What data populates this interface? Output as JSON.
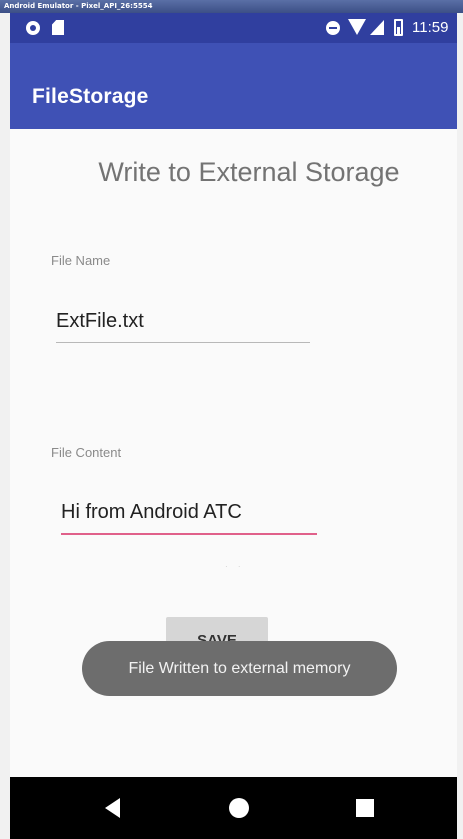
{
  "emulator": {
    "window_title": "Android Emulator - Pixel_API_26:5554"
  },
  "status_bar": {
    "time": "11:59",
    "icons": [
      "notification-icon",
      "sd-card-icon",
      "do-not-disturb-icon",
      "wifi-icon",
      "cell-signal-icon",
      "battery-icon"
    ]
  },
  "app_bar": {
    "title": "FileStorage"
  },
  "main": {
    "heading": "Write to External Storage",
    "file_name": {
      "label": "File Name",
      "value": "ExtFile.txt"
    },
    "file_content": {
      "label": "File Content",
      "value": "Hi from Android ATC"
    },
    "save_button": "SAVE",
    "toast": "File Written to external memory"
  },
  "nav_bar": {
    "icons": [
      "back-icon",
      "home-icon",
      "recents-icon"
    ]
  },
  "colors": {
    "status_bar": "#303f9f",
    "app_bar": "#3f51b5",
    "focus_underline": "#e0608a",
    "toast": "#6d6d6d"
  }
}
